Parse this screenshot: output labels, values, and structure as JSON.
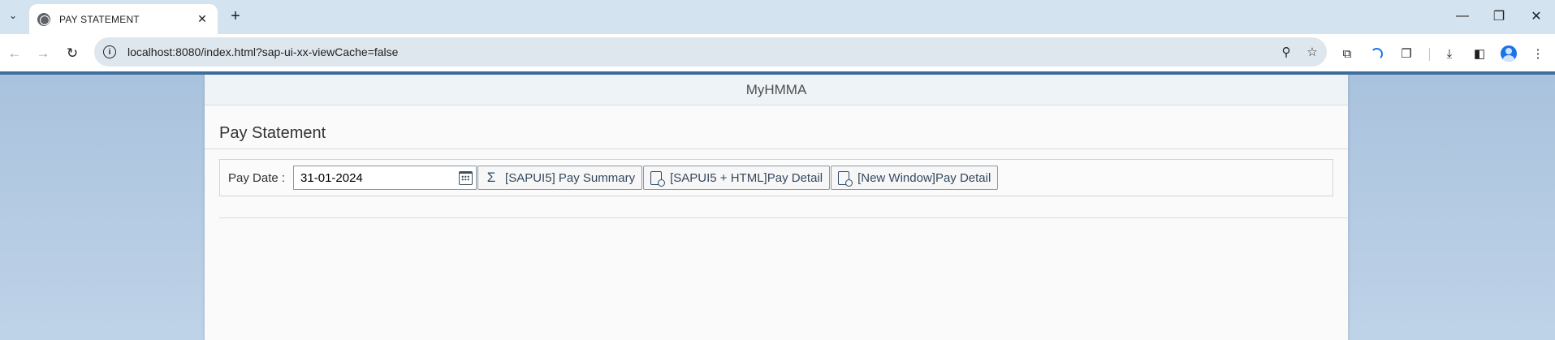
{
  "browser": {
    "tab_title": "PAY STATEMENT",
    "url": "localhost:8080/index.html?sap-ui-xx-viewCache=false"
  },
  "icons": {
    "tab_menu": "chevron-down-icon",
    "favicon": "globe-icon",
    "tab_close": "close-icon",
    "new_tab": "plus-icon",
    "back": "arrow-left-icon",
    "forward": "arrow-right-icon",
    "reload": "reload-icon",
    "site_info": "info-icon",
    "zoom": "zoom-icon",
    "bookmark": "star-icon",
    "calendar": "calendar-icon",
    "summary": "sigma-icon",
    "detail": "document-search-icon"
  },
  "shell": {
    "title": "MyHMMA"
  },
  "page": {
    "title": "Pay Statement"
  },
  "form": {
    "pay_date_label": "Pay Date :",
    "pay_date_value": "31-01-2024",
    "buttons": {
      "pay_summary": "[SAPUI5] Pay Summary",
      "pay_detail_html": "[SAPUI5 + HTML]Pay Detail",
      "pay_detail_window": "[New Window]Pay Detail"
    }
  },
  "colors": {
    "tabbar_bg": "#d3e3ef",
    "page_bg": "#a9c2dd",
    "accent_bar": "#3d6f9e",
    "button_text": "#34495e"
  }
}
